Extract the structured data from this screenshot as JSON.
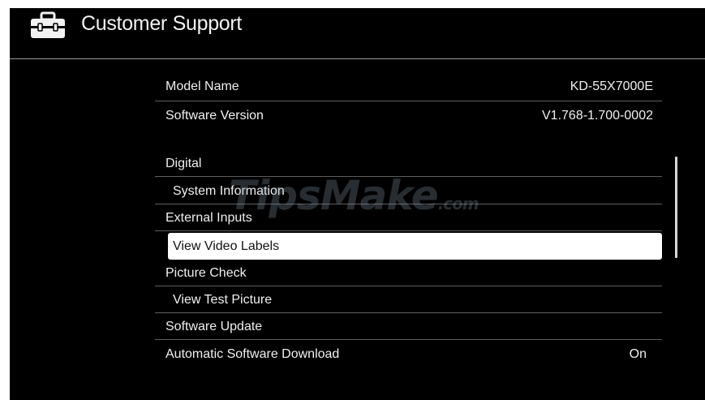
{
  "header": {
    "title": "Customer Support",
    "icon": "toolbox-icon"
  },
  "info": [
    {
      "label": "Model Name",
      "value": "KD-55X7000E"
    },
    {
      "label": "Software Version",
      "value": "V1.768-1.700-0002"
    }
  ],
  "menu": {
    "items": [
      {
        "label": "Digital",
        "kind": "section"
      },
      {
        "label": "System Information",
        "kind": "option"
      },
      {
        "label": "External Inputs",
        "kind": "section"
      },
      {
        "label": "View Video Labels",
        "kind": "option",
        "selected": true
      },
      {
        "label": "Picture Check",
        "kind": "section"
      },
      {
        "label": "View Test Picture",
        "kind": "option"
      },
      {
        "label": "Software Update",
        "kind": "section"
      },
      {
        "label": "Automatic Software Download",
        "kind": "section",
        "value": "On"
      }
    ]
  },
  "watermark": {
    "brand": "TipsMake",
    "suffix": ".com"
  },
  "colors": {
    "background": "#000000",
    "text": "#f0f0f0",
    "selection": "#ffffff",
    "divider": "#5e5e5e"
  }
}
